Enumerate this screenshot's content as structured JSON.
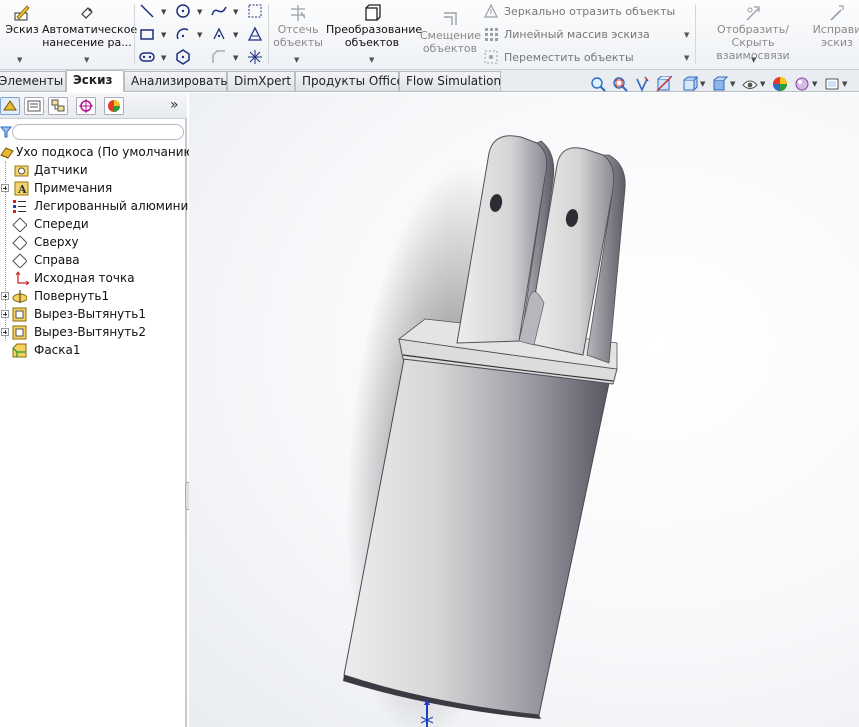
{
  "ribbon": {
    "sketch": "Эскиз",
    "smart_dim_line1": "Автоматическое",
    "smart_dim_line2": "нанесение ра...",
    "trim_line1": "Отсечь",
    "trim_line2": "объекты",
    "convert_line1": "Преобразование",
    "convert_line2": "объектов",
    "offset_line1": "Смещение",
    "offset_line2": "объектов",
    "mirror": "Зеркально отразить объекты",
    "linear_pattern": "Линейный массив эскиза",
    "move": "Переместить объекты",
    "relations_line1": "Отобразить/Скрыть",
    "relations_line2": "взаимосвязи",
    "repair_line1": "Исправи",
    "repair_line2": "эскиз"
  },
  "tabs": [
    {
      "label": "Элементы",
      "active": false
    },
    {
      "label": "Эскиз",
      "active": true
    },
    {
      "label": "Анализировать",
      "active": false
    },
    {
      "label": "DimXpert",
      "active": false
    },
    {
      "label": "Продукты Office",
      "active": false
    },
    {
      "label": "Flow Simulation",
      "active": false
    }
  ],
  "panel": {
    "collapse_label": "»",
    "tree": [
      {
        "label": "Ухо подкоса  (По умолчанию<",
        "icon": "part-icon",
        "expandable": false
      },
      {
        "label": "Датчики",
        "icon": "sensors-folder-icon",
        "expandable": false
      },
      {
        "label": "Примечания",
        "icon": "annotations-icon",
        "expandable": true
      },
      {
        "label": "Легированный алюминий (",
        "icon": "material-icon",
        "expandable": false
      },
      {
        "label": "Спереди",
        "icon": "plane-icon",
        "expandable": false
      },
      {
        "label": "Сверху",
        "icon": "plane-icon",
        "expandable": false
      },
      {
        "label": "Справа",
        "icon": "plane-icon",
        "expandable": false
      },
      {
        "label": "Исходная точка",
        "icon": "origin-icon",
        "expandable": false
      },
      {
        "label": "Повернуть1",
        "icon": "revolve-icon",
        "expandable": true
      },
      {
        "label": "Вырез-Вытянуть1",
        "icon": "cut-extrude-icon",
        "expandable": true
      },
      {
        "label": "Вырез-Вытянуть2",
        "icon": "cut-extrude-icon",
        "expandable": true
      },
      {
        "label": "Фаска1",
        "icon": "chamfer-icon",
        "expandable": false
      }
    ]
  },
  "colors": {
    "accent": "#2b6cc4",
    "model_light": "#e2e2e2",
    "model_dark": "#6b6873"
  }
}
